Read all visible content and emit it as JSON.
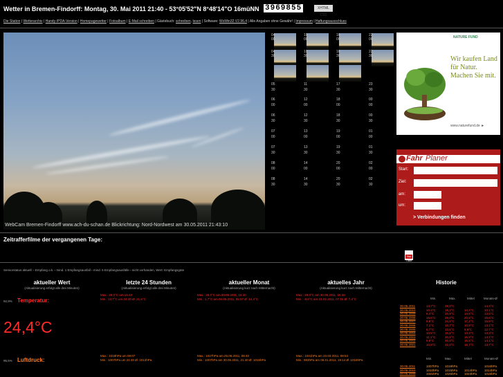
{
  "header": {
    "title": "Wetter in Bremen-Findorff:  Montag, 30. Mai 2011  21:40  -  53°05'52\"N 8°48'14\"O  16müNN",
    "counter": "3969855",
    "badge": "XHTML CSS"
  },
  "nav": {
    "items": [
      "Die Station",
      "Wetterarchiv",
      "Handy-/PDA-Version",
      "Homepagewetter",
      "Fotoalbum",
      "E-Mail schreiben"
    ],
    "guestbook_label": "Gästebuch:",
    "guestbook_links": [
      "schreiben",
      "lesen"
    ],
    "software_label": "Software:",
    "software_link": "WsWin32 V2.96.4",
    "disclaimer": "Alle Angaben ohne Gewähr!",
    "impressum": "Impressum",
    "haftung": "Haftungsausschluss"
  },
  "webcam": {
    "caption": "WebCam Bremen-Findorff     www.ach-du-schan.de     Blickrichtung: Nord-Nordwest am 30.05.2011  21:43:10"
  },
  "thumbs": {
    "labels": [
      [
        "04",
        "00"
      ],
      [
        "10",
        "00"
      ],
      [
        "16",
        "00"
      ],
      [
        "22",
        "00"
      ],
      [
        "04",
        "30"
      ],
      [
        "10",
        "30"
      ],
      [
        "16",
        "30"
      ],
      [
        "22",
        "30"
      ],
      [
        "05",
        "00"
      ],
      [
        "11",
        "00"
      ],
      [
        "17",
        "00"
      ],
      [
        "23",
        "00"
      ],
      [
        "05",
        "30"
      ],
      [
        "11",
        "30"
      ],
      [
        "17",
        "30"
      ],
      [
        "23",
        "30"
      ],
      [
        "06",
        "00"
      ],
      [
        "12",
        "00"
      ],
      [
        "18",
        "00"
      ],
      [
        "00",
        "00"
      ],
      [
        "06",
        "30"
      ],
      [
        "12",
        "30"
      ],
      [
        "18",
        "30"
      ],
      [
        "00",
        "30"
      ],
      [
        "07",
        "00"
      ],
      [
        "13",
        "00"
      ],
      [
        "19",
        "00"
      ],
      [
        "01",
        "00"
      ],
      [
        "07",
        "30"
      ],
      [
        "13",
        "30"
      ],
      [
        "19",
        "30"
      ],
      [
        "01",
        "30"
      ],
      [
        "08",
        "00"
      ],
      [
        "14",
        "00"
      ],
      [
        "20",
        "00"
      ],
      [
        "02",
        "00"
      ],
      [
        "08",
        "30"
      ],
      [
        "14",
        "30"
      ],
      [
        "20",
        "30"
      ],
      [
        "02",
        "30"
      ],
      [
        "09",
        "00"
      ],
      [
        "15",
        "00"
      ],
      [
        "21",
        "00"
      ],
      [
        "03",
        "00"
      ],
      [
        "09",
        "30"
      ],
      [
        "15",
        "30"
      ],
      [
        "21",
        "30"
      ],
      [
        "03",
        "30"
      ]
    ]
  },
  "ad": {
    "logo": "NATURE FUND",
    "text": "Wir kaufen Land für Natur. Machen Sie mit.",
    "url": "www.naturefund.de ►"
  },
  "fahrplaner": {
    "title_a": "Fahr",
    "title_b": "Planer",
    "start": "Start:",
    "ziel": "Ziel:",
    "am": "am:",
    "um": "um:",
    "button": "> Verbindungen finden"
  },
  "zeitraffer": {
    "title": "Zeitrafferfilme der vergangenen Tage:",
    "yt": "You Tube"
  },
  "legend": "Sensorstatus aktuell:  ▫ Empfang o.k.  ▫ mind. 1 Empfangsausfall  ▫ mind. 5 Empfangsausfälle  ▫ nicht vorhanden, Wert: Empfangsgüte",
  "columns": [
    {
      "title": "aktueller Wert",
      "sub": "(Aktualisierung erfolgt alle drei Minuten)"
    },
    {
      "title": "letzte 24 Stunden",
      "sub": "(Aktualisierung erfolgt alle drei Minuten)"
    },
    {
      "title": "aktueller Monat",
      "sub": "(Aktualisierung kurz nach Mitternacht)"
    },
    {
      "title": "aktuelles Jahr",
      "sub": "(Aktualisierung kurz nach Mitternacht)"
    },
    {
      "title": "Historie",
      "sub": ""
    }
  ],
  "temperature": {
    "status": "92,9%",
    "label": "Temperatur:",
    "value": "24,4°C",
    "h24": [
      "Max.: 29,0°C um 16:40",
      "Min.: 13,7°C um 04:40 Ø: 21,6°C"
    ],
    "month": [
      "Max.: 29,0°C am 30.05.2011, 16:40",
      "Min.: 1,7°C am 06.05.2011, 05:57 Ø: 14,4°C"
    ],
    "year": [
      "Max.: 29,0°C am 30.05.2011, 16:40",
      "Min.: -8,6°C am 23.02.2011, 07:16 Ø: 7,4°C"
    ]
  },
  "pressure": {
    "status": "95,5%",
    "label": "Luftdruck:",
    "h24": [
      "Max.: 1019hPa um 09:07",
      "Min.: 1007hPa um 21:40 Ø: 1012hPa"
    ],
    "month": [
      "Max.: 1027hPa am 25.05.2011, 08:40",
      "Min.: 1007hPa am 30.05.2011, 21:40 Ø: 1016hPa"
    ],
    "year": [
      "Max.: 1041hPa am 23.03.2011, 08:53",
      "Min.: 993hPa am 06.01.2011, 19:14 Ø: 1016hPa"
    ]
  },
  "history": {
    "headers": [
      "Min.",
      "Max.",
      "Mittel",
      "Monats-Ø"
    ],
    "temp_rows": [
      [
        "30.05.2011",
        "13,7°C",
        "29,0°C",
        "",
        "14,4°C"
      ],
      [
        "30.05.2010",
        "10,4°C",
        "18,3°C",
        "14,4°C",
        "10,1°C"
      ],
      [
        "30.05.2009",
        "8,4°C",
        "20,9°C",
        "14,6°C",
        "13,5°C"
      ],
      [
        "30.05.2008",
        "15,6°C",
        "29,0°C",
        "20,6°C",
        "15,6°C"
      ],
      [
        "30.05.2007",
        "9,9°C",
        "24,6°C",
        "17,4°C",
        "15,9°C"
      ],
      [
        "30.05.2006",
        "7,1°C",
        "13,7°C",
        "10,9°C",
        "13,1°C"
      ],
      [
        "30.05.2005",
        "6,7°C",
        "13,5°C",
        "9,9°C",
        "12,7°C"
      ],
      [
        "30.05.2004",
        "10,5°C",
        "16,5°C",
        "13,3°C",
        "13,3°C"
      ],
      [
        "30.05.2003",
        "11,1°C",
        "20,5°C",
        "15,9°C",
        "14,1°C"
      ],
      [
        "30.05.2002",
        "9,8°C",
        "20,6°C",
        "15,5°C",
        "14,1°C"
      ],
      [
        "30.05.2001",
        "10,8°C",
        "22,0°C",
        "16,7°C",
        "13,7°C"
      ]
    ],
    "press_headers": [
      "Min.",
      "Max.",
      "Mittel",
      "Monats-Ø"
    ],
    "press_rows": [
      [
        "30.05.2011",
        "1007hPa",
        "1019hPa",
        "",
        "1016hPa"
      ],
      [
        "30.05.2010",
        "1010hPa",
        "1015hPa",
        "1014hPa",
        "1014hPa"
      ],
      [
        "30.05.2009",
        "1021hPa",
        "1025hPa",
        "1023hPa",
        "1015hPa"
      ]
    ]
  }
}
